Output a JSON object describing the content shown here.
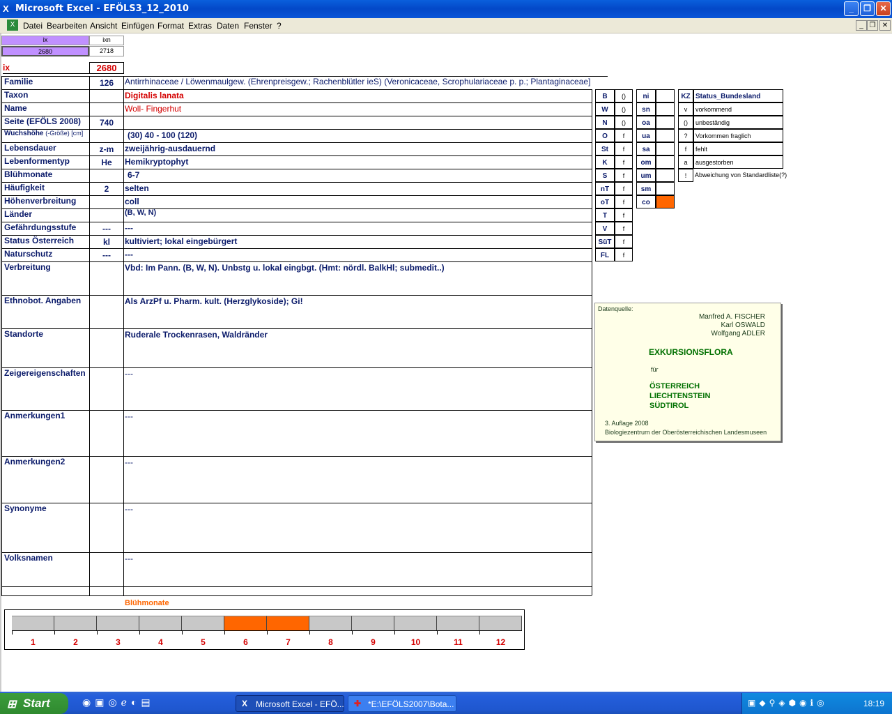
{
  "window": {
    "title": "Microsoft Excel - EFÖLS3_12_2010",
    "app_icon": "excel-icon"
  },
  "menu": [
    "Datei",
    "Bearbeiten",
    "Ansicht",
    "Einfügen",
    "Format",
    "Extras",
    "Daten",
    "Fenster",
    "?"
  ],
  "top_index": {
    "ix_header": "ix",
    "ixn_header": "ixn",
    "ix_value": "2680",
    "ixn_value": "2718",
    "ix_label": "ix",
    "ix_big_value": "2680"
  },
  "fields": [
    {
      "label": "Familie",
      "code": "126",
      "value": "Antirrhinaceae  /  Löwenmaulgew. (Ehrenpreisgew.; Rachenblütler ieS) (Veronicaceae, Scrophulariaceae p. p.; Plantaginaceae]"
    },
    {
      "label": "Taxon",
      "code": "",
      "value": "Digitalis lanata"
    },
    {
      "label": "Name",
      "code": "",
      "value": "Woll- Fingerhut"
    },
    {
      "label": "Seite (EFÖLS 2008)",
      "code": "740",
      "value": ""
    },
    {
      "label": "Wuchshöhe",
      "label_small": "(-Größe) [cm]",
      "code": "",
      "value": "(30) 40 - 100 (120)"
    },
    {
      "label": "Lebensdauer",
      "code": "z-m",
      "value": "zweijährig-ausdauernd"
    },
    {
      "label": "Lebenformentyp",
      "code": "He",
      "value": "Hemikryptophyt"
    },
    {
      "label": "Blühmonate",
      "code": "",
      "value": "6-7"
    },
    {
      "label": "Häufigkeit",
      "code": "2",
      "value": "selten"
    },
    {
      "label": "Höhenverbreitung",
      "code": "",
      "value": "coll"
    },
    {
      "label": "Länder",
      "code": "",
      "value": "(B, W, N)"
    },
    {
      "label": "Gefährdungsstufe",
      "code": "---",
      "value": "---"
    },
    {
      "label": "Status Österreich",
      "code": "kl",
      "value": "kultiviert; lokal eingebürgert"
    },
    {
      "label": "Naturschutz",
      "code": "---",
      "value": "---"
    },
    {
      "label": "Verbreitung",
      "code": "",
      "value": "Vbd: Im Pann. (B, W, N). Unbstg u. lokal eingbgt. (Hmt: nördl. BalkHl; submedit..)"
    },
    {
      "label": "Ethnobot. Angaben",
      "code": "",
      "value": "Als ArzPf u. Pharm. kult. (Herzglykoside); Gi!"
    },
    {
      "label": "Standorte",
      "code": "",
      "value": "Ruderale Trockenrasen, Waldränder"
    },
    {
      "label": "Zeigereigenschaften",
      "code": "",
      "value": "---"
    },
    {
      "label": "Anmerkungen1",
      "code": "",
      "value": "---"
    },
    {
      "label": "Anmerkungen2",
      "code": "",
      "value": "---"
    },
    {
      "label": "Synonyme",
      "code": "",
      "value": "---"
    },
    {
      "label": "Volksnamen",
      "code": "",
      "value": "---"
    }
  ],
  "bundesland": [
    {
      "k": "B",
      "v": "()"
    },
    {
      "k": "W",
      "v": "()"
    },
    {
      "k": "N",
      "v": "()"
    },
    {
      "k": "O",
      "v": "f"
    },
    {
      "k": "St",
      "v": "f"
    },
    {
      "k": "K",
      "v": "f"
    },
    {
      "k": "S",
      "v": "f"
    },
    {
      "k": "nT",
      "v": "f"
    },
    {
      "k": "oT",
      "v": "f"
    },
    {
      "k": "T",
      "v": "f"
    },
    {
      "k": "V",
      "v": "f"
    },
    {
      "k": "SüT",
      "v": "f"
    },
    {
      "k": "FL",
      "v": "f"
    }
  ],
  "hoehen": [
    {
      "k": "ni",
      "v": ""
    },
    {
      "k": "sn",
      "v": ""
    },
    {
      "k": "oa",
      "v": ""
    },
    {
      "k": "ua",
      "v": ""
    },
    {
      "k": "sa",
      "v": ""
    },
    {
      "k": "om",
      "v": ""
    },
    {
      "k": "um",
      "v": ""
    },
    {
      "k": "sm",
      "v": ""
    },
    {
      "k": "co",
      "v": "",
      "highlight": true
    }
  ],
  "legend": {
    "kz_header": "KZ",
    "status_header": "Status_Bundesland",
    "rows": [
      {
        "kz": "v",
        "text": "vorkommend"
      },
      {
        "kz": "()",
        "text": "unbeständig"
      },
      {
        "kz": "?",
        "text": "Vorkommen fraglich"
      },
      {
        "kz": "f",
        "text": "fehlt"
      },
      {
        "kz": "a",
        "text": "ausgestorben"
      },
      {
        "kz": "!",
        "text": "Abweichung von Standardliste(?)"
      }
    ]
  },
  "datenquelle": {
    "label": "Datenquelle:",
    "authors": [
      "Manfred A. FISCHER",
      "Karl OSWALD",
      "Wolfgang ADLER"
    ],
    "title": "EXKURSIONSFLORA",
    "fuer": "für",
    "countries": [
      "ÖSTERREICH",
      "LIECHTENSTEIN",
      "SÜDTIROL"
    ],
    "edition": "3. Auflage 2008",
    "publisher": "Biologiezentrum der Oberösterreichischen Landesmuseen"
  },
  "bluehmonate_chart": {
    "title": "Blühmonate",
    "months": [
      "1",
      "2",
      "3",
      "4",
      "5",
      "6",
      "7",
      "8",
      "9",
      "10",
      "11",
      "12"
    ],
    "active": [
      6,
      7
    ],
    "colors": {
      "active": "#ff6600",
      "inactive": "#c8c8c8"
    }
  },
  "taskbar": {
    "start": "Start",
    "tasks": [
      "Microsoft Excel - EFÖ...",
      "*E:\\EFÖLS2007\\Bota..."
    ],
    "clock": "18:19"
  },
  "colors": {
    "accent_orange": "#ff6600",
    "purple": "#c090ff",
    "red": "#d40000",
    "label_blue": "#0a1a6a"
  }
}
